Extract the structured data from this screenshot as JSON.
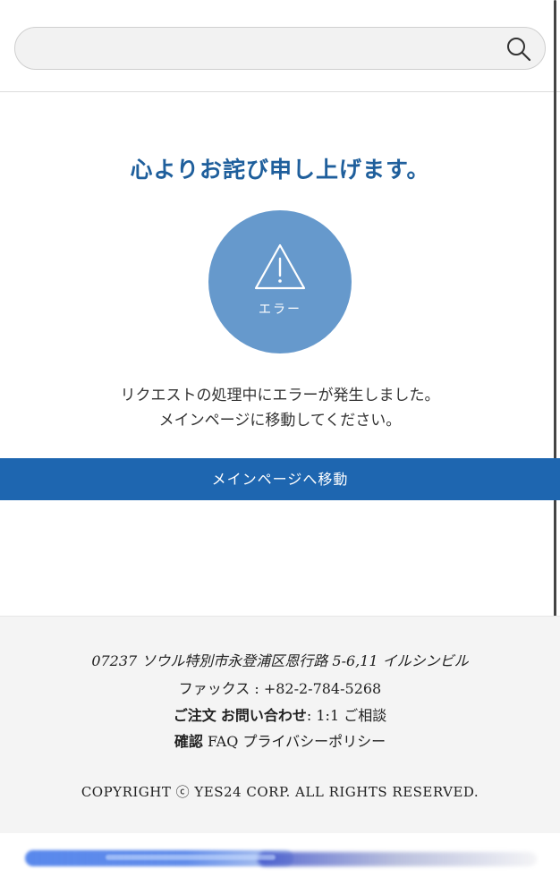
{
  "search": {
    "placeholder": "",
    "value": ""
  },
  "error_page": {
    "title": "心よりお詫び申し上げます。",
    "icon_label": "エラー",
    "message_line1": "リクエストの処理中にエラーが発生しました。",
    "message_line2": "メインページに移動してください。",
    "main_button": "メインページへ移動"
  },
  "footer": {
    "address": "07237 ソウル特別市永登浦区恩行路 5-6,11 イルシンビル",
    "fax": "ファックス : +82-2-784-5268",
    "order_confirm_prefix": "ご注文",
    "inquiry_link": "お問い合わせ",
    "inquiry_sep": ": 1:1 ご相談",
    "confirm_suffix": "確認",
    "faq_link": "FAQ",
    "privacy_link": "プライバシーポリシー",
    "copyright": "COPYRIGHT ⓒ YES24 CORP. ALL RIGHTS RESERVED."
  },
  "colors": {
    "title": "#1f5f9c",
    "circle": "#6699cc",
    "button": "#1e66b0",
    "footer_bg": "#f4f4f4"
  }
}
